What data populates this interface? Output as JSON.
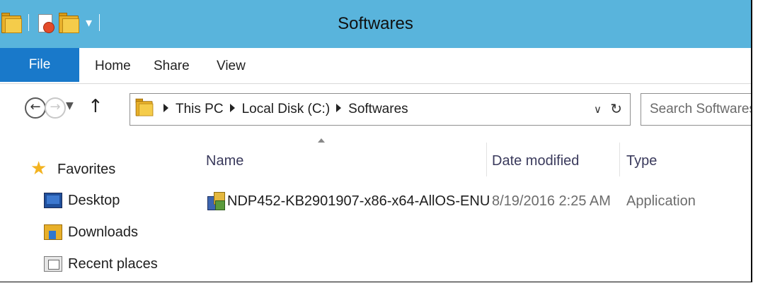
{
  "window": {
    "title": "Softwares"
  },
  "ribbon": {
    "tabs": [
      "File",
      "Home",
      "Share",
      "View"
    ]
  },
  "nav": {
    "breadcrumb": [
      "This PC",
      "Local Disk (C:)",
      "Softwares"
    ],
    "search_placeholder": "Search Softwares"
  },
  "sidebar": {
    "favorites_label": "Favorites",
    "items": [
      {
        "label": "Desktop",
        "icon": "desktop-icon"
      },
      {
        "label": "Downloads",
        "icon": "downloads-folder-icon"
      },
      {
        "label": "Recent places",
        "icon": "recent-places-icon"
      }
    ]
  },
  "columns": [
    "Name",
    "Date modified",
    "Type"
  ],
  "files": [
    {
      "name": "NDP452-KB2901907-x86-x64-AllOS-ENU",
      "date_modified": "8/19/2016 2:25 AM",
      "type": "Application",
      "icon": "application-icon"
    }
  ],
  "colors": {
    "titlebar": "#59b4dc",
    "file_tab": "#1979ca",
    "favorites_star": "#f3b320"
  }
}
